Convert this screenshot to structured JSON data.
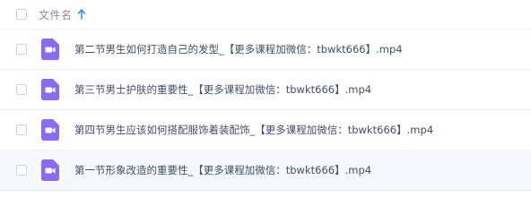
{
  "header": {
    "column_label": "文件名"
  },
  "files": [
    {
      "name": "第二节男生如何打造自己的发型_【更多课程加微信：tbwkt666】.mp4",
      "selected": false
    },
    {
      "name": "第三节男士护肤的重要性_【更多课程加微信：tbwkt666】.mp4",
      "selected": false
    },
    {
      "name": "第四节男生应该如何搭配服饰着装配饰_【更多课程加微信：tbwkt666】.mp4",
      "selected": false
    },
    {
      "name": "第一节形象改造的重要性_【更多课程加微信：tbwkt666】.mp4",
      "selected": true
    }
  ],
  "colors": {
    "video_icon": "#8b6cf0",
    "sort_arrow": "#3b8cff",
    "selected_row": "#f5f9ff"
  },
  "icons": {
    "sort": "arrow-up-icon",
    "file": "video-file-icon"
  }
}
